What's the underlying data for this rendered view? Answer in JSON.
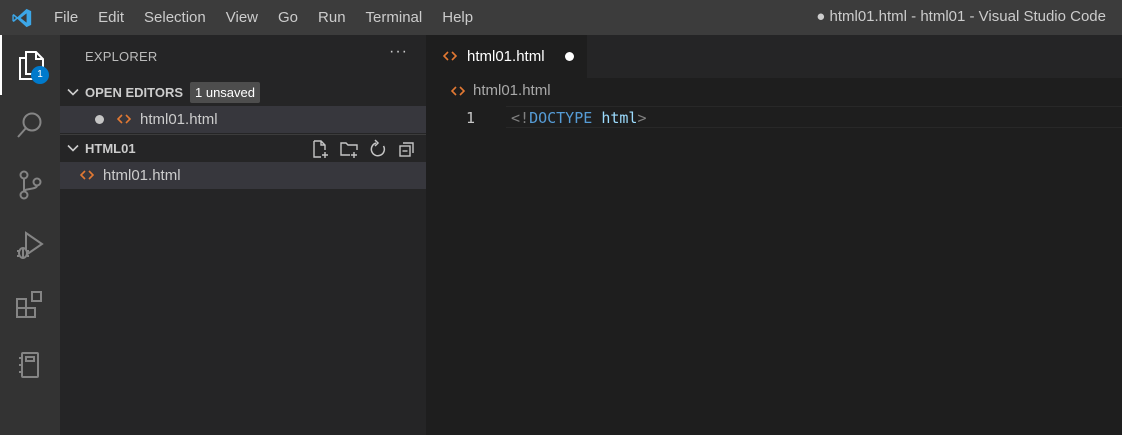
{
  "menu": [
    "File",
    "Edit",
    "Selection",
    "View",
    "Go",
    "Run",
    "Terminal",
    "Help"
  ],
  "window_title": "● html01.html - html01 - Visual Studio Code",
  "activity_bar": {
    "items": [
      "explorer-icon",
      "search-icon",
      "source-control-icon",
      "run-debug-icon",
      "extensions-icon",
      "notebook-icon"
    ],
    "explorer_badge": "1"
  },
  "sidebar": {
    "title": "EXPLORER",
    "more": "···",
    "open_editors": {
      "label": "OPEN EDITORS",
      "badge": "1 unsaved",
      "files": [
        "html01.html"
      ]
    },
    "folder": {
      "label": "HTML01",
      "actions": [
        "new-file-icon",
        "new-folder-icon",
        "refresh-icon",
        "collapse-all-icon"
      ],
      "files": [
        "html01.html"
      ]
    }
  },
  "editor": {
    "tab_label": "html01.html",
    "breadcrumb": "html01.html",
    "line_number": "1",
    "code": {
      "open": "<!",
      "doctype": "DOCTYPE",
      "space": " ",
      "html": "html",
      "close": ">"
    }
  },
  "colors": {
    "accent": "#007acc",
    "html_icon": "#e37933",
    "titlebar": "#3c3c3c",
    "activitybar": "#333333",
    "sidebar": "#252526",
    "editor": "#1e1e1e"
  }
}
